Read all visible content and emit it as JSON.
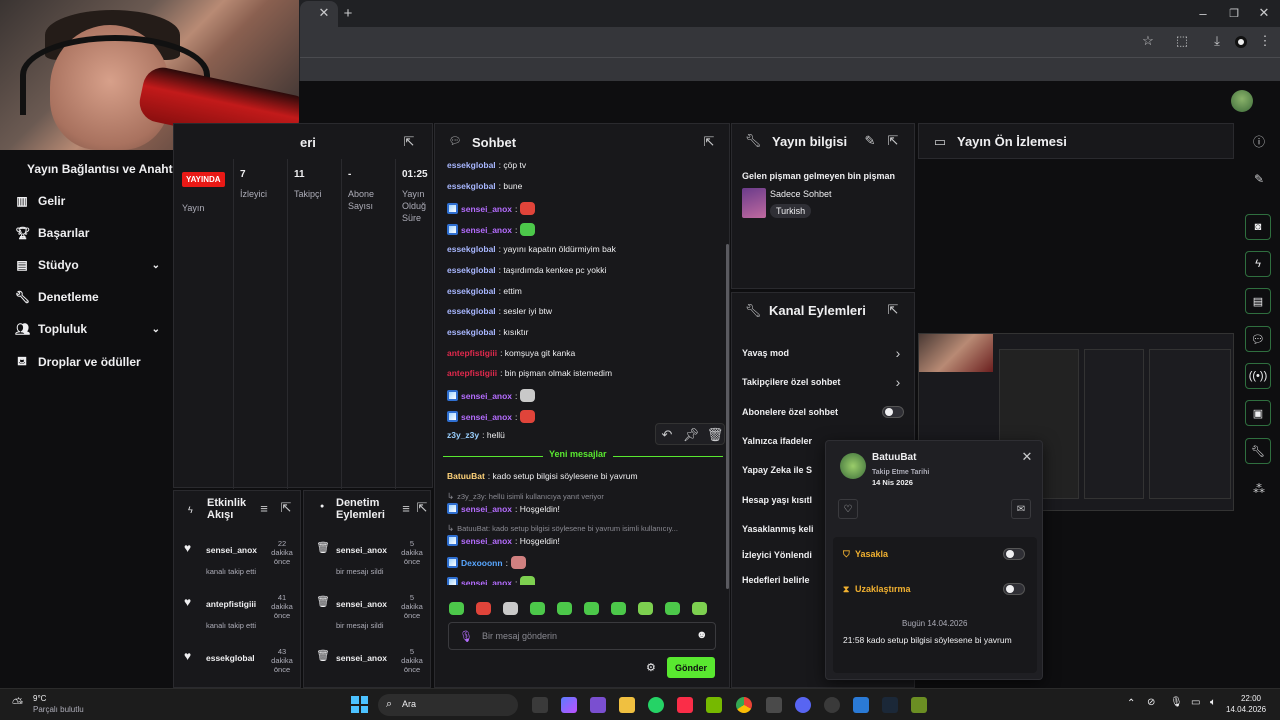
{
  "sidebar": {
    "header": "Yayın Bağlantısı ve Anahtarı",
    "items": [
      {
        "label": "Gelir",
        "icon": "chart-bar-icon",
        "expandable": false
      },
      {
        "label": "Başarılar",
        "icon": "trophy-icon",
        "expandable": false
      },
      {
        "label": "Stüdyo",
        "icon": "studio-icon",
        "expandable": true
      },
      {
        "label": "Denetleme",
        "icon": "wrench-icon",
        "expandable": false
      },
      {
        "label": "Topluluk",
        "icon": "people-icon",
        "expandable": true
      },
      {
        "label": "Droplar ve ödüller",
        "icon": "gift-icon",
        "expandable": false
      }
    ]
  },
  "stats": {
    "title_partial": "eri",
    "live_badge": "YAYINDA",
    "live_label": "Yayın",
    "cols": [
      {
        "value": "7",
        "label": "İzleyici"
      },
      {
        "value": "11",
        "label": "Takipçi"
      },
      {
        "value": "-",
        "label": "Abone Sayısı"
      },
      {
        "value": "01:25",
        "label": "Yayın Olduğ Süre"
      }
    ]
  },
  "chat": {
    "title": "Sohbet",
    "messages": [
      {
        "user": "essekglobal",
        "color": "#a8b7ff",
        "text": ": çöp tv",
        "badge": false
      },
      {
        "user": "essekglobal",
        "color": "#a8b7ff",
        "text": ": bune",
        "badge": false
      },
      {
        "user": "sensei_anox",
        "color": "#b56dff",
        "text": ":",
        "badge": true,
        "emote": "#e0443a"
      },
      {
        "user": "sensei_anox",
        "color": "#b56dff",
        "text": ":",
        "badge": true,
        "emote": "#4cc84a"
      },
      {
        "user": "essekglobal",
        "color": "#a8b7ff",
        "text": ": yayını kapatın öldürmiyim bak",
        "badge": false
      },
      {
        "user": "essekglobal",
        "color": "#a8b7ff",
        "text": ": taşırdımda kenkee pc yokki",
        "badge": false
      },
      {
        "user": "essekglobal",
        "color": "#a8b7ff",
        "text": ": ettim",
        "badge": false
      },
      {
        "user": "essekglobal",
        "color": "#a8b7ff",
        "text": ": sesler iyi btw",
        "badge": false
      },
      {
        "user": "essekglobal",
        "color": "#a8b7ff",
        "text": ": kısıktır",
        "badge": false
      },
      {
        "user": "antepfistigiii",
        "color": "#e0294d",
        "text": ": komşuya git kanka",
        "badge": false
      },
      {
        "user": "antepfistigiii",
        "color": "#e0294d",
        "text": ": bin pişman olmak istemedim",
        "badge": false
      },
      {
        "user": "sensei_anox",
        "color": "#b56dff",
        "text": ":",
        "badge": true,
        "emote": "#c9c9c9"
      },
      {
        "user": "sensei_anox",
        "color": "#b56dff",
        "text": ":",
        "badge": true,
        "emote": "#e0443a"
      },
      {
        "user": "z3y_z3y",
        "color": "#9ad0ff",
        "text": ": hellü",
        "badge": false
      }
    ],
    "new_messages_label": "Yeni mesajlar",
    "after": [
      {
        "user": "BatuuBat",
        "color": "#ffd37a",
        "text": ": kado setup bilgisi söylesene bi yavrum",
        "badge": false
      },
      {
        "reply": "z3y_z3y: hellü isimli kullanıcıya yanıt veriyor"
      },
      {
        "user": "sensei_anox",
        "color": "#b56dff",
        "text": ": Hoşgeldin!",
        "badge": true
      },
      {
        "reply": "BatuuBat: kado setup bilgisi söylesene bi yavrum isimli kullanıcıy..."
      },
      {
        "user": "sensei_anox",
        "color": "#b56dff",
        "text": ": Hoşgeldin!",
        "badge": true
      },
      {
        "user": "Dexooonn",
        "color": "#58a6ff",
        "text": ":",
        "badge": true,
        "emote": "#d08080"
      },
      {
        "user": "sensei_anox",
        "color": "#b56dff",
        "text": ":",
        "badge": true,
        "emote": "#7dd050"
      }
    ],
    "emote_colors": [
      "#4cc84a",
      "#e0443a",
      "#c9c9c9",
      "#4cc84a",
      "#4cc84a",
      "#4cc84a",
      "#4cc84a",
      "#7dd050",
      "#4cc84a",
      "#7dd050"
    ],
    "placeholder": "Bir mesaj gönderin",
    "send_label": "Gönder"
  },
  "info": {
    "title": "Yayın bilgisi",
    "stream_title": "Gelen pişman gelmeyen bin pişman",
    "category": "Sadece Sohbet",
    "tag": "Turkish"
  },
  "actions": {
    "title": "Kanal Eylemleri",
    "items": [
      {
        "label": "Yavaş mod",
        "control": "chevron"
      },
      {
        "label": "Takipçilere özel sohbet",
        "control": "chevron"
      },
      {
        "label": "Abonelere özel sohbet",
        "control": "toggle"
      },
      {
        "label": "Yalnızca ifadeler",
        "control": "none"
      },
      {
        "label": "Yapay Zeka ile S",
        "control": "none"
      },
      {
        "label": "Hesap yaşı kısıtl",
        "control": "none"
      },
      {
        "label": "Yasaklanmış keli",
        "control": "none"
      },
      {
        "label": "İzleyici Yönlendi",
        "control": "none"
      },
      {
        "label": "Hedefleri belirle",
        "control": "none"
      }
    ]
  },
  "preview": {
    "title": "Yayın Ön İzlemesi"
  },
  "popup": {
    "username": "BatuuBat",
    "follow_label": "Takip Etme Tarihi",
    "follow_date": "14 Nis 2026",
    "ban_label": "Yasakla",
    "timeout_label": "Uzaklaştırma",
    "date_divider": "Bugün 14.04.2026",
    "history_line": "21:58 kado setup bilgisi söylesene bi yavrum"
  },
  "events": {
    "title": "Etkinlik Akışı",
    "items": [
      {
        "user": "sensei_anox",
        "time": "22 dakika önce",
        "desc": "kanalı takip etti"
      },
      {
        "user": "antepfistigiii",
        "time": "41 dakika önce",
        "desc": "kanalı takip etti"
      },
      {
        "user": "essekglobal",
        "time": "43 dakika önce",
        "desc": "kanalı takip etti"
      }
    ]
  },
  "modactions": {
    "title": "Denetim Eylemleri",
    "items": [
      {
        "user": "sensei_anox",
        "time": "5 dakika önce",
        "desc": "bir mesajı sildi"
      },
      {
        "user": "sensei_anox",
        "time": "5 dakika önce",
        "desc": "bir mesajı sildi"
      },
      {
        "user": "sensei_anox",
        "time": "5 dakika önce",
        "desc": ""
      }
    ]
  },
  "taskbar": {
    "weather_temp": "9°C",
    "weather_desc": "Parçalı bulutlu",
    "search_label": "Ara",
    "time": "22:00",
    "date": "14.04.2026"
  }
}
